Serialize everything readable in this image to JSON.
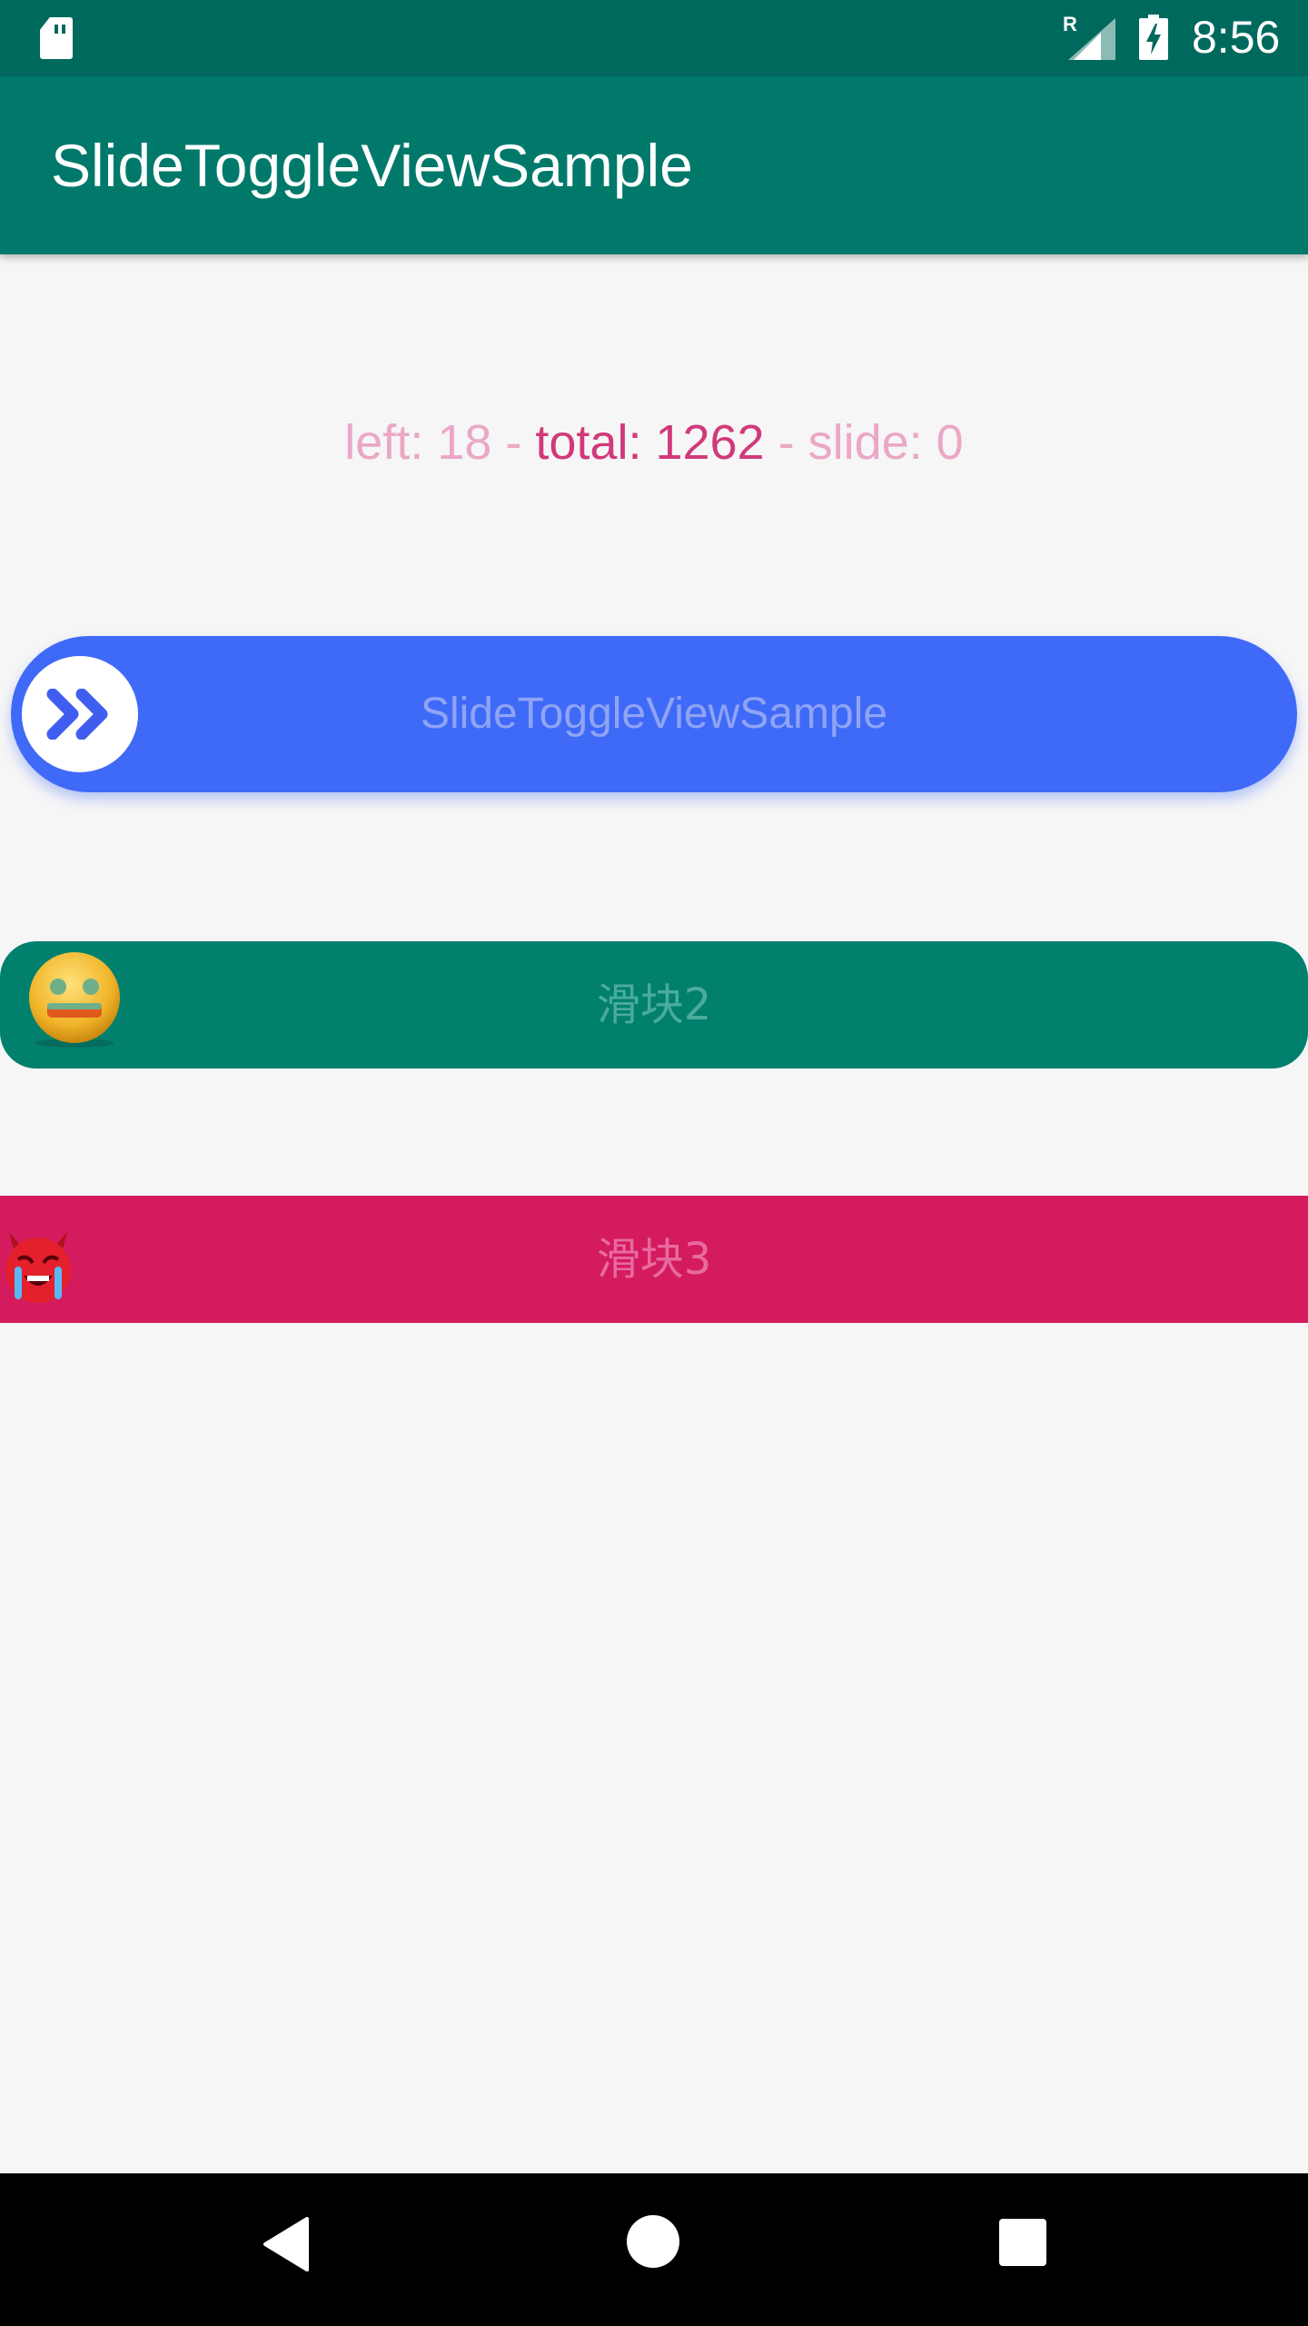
{
  "status_bar": {
    "time": "8:56",
    "network_label": "R",
    "icons": [
      "sd-card-icon",
      "signal-icon",
      "battery-charging-icon"
    ]
  },
  "app_bar": {
    "title": "SlideToggleViewSample"
  },
  "info": {
    "left": "left: 18",
    "separator": " - ",
    "total": "total: 1262",
    "slide": "slide: 0"
  },
  "sliders": [
    {
      "label": "SlideToggleViewSample",
      "thumb_icon": "double-chevron-right-icon",
      "color": "#3f69f7"
    },
    {
      "label": "滑块2",
      "thumb_icon": "smiley-face-icon",
      "color": "#00806d"
    },
    {
      "label": "滑块3",
      "thumb_icon": "devil-face-icon",
      "color": "#d41b5e"
    }
  ],
  "nav_bar": {
    "icons": [
      "back-icon",
      "home-icon",
      "recents-icon"
    ]
  },
  "colors": {
    "status_bar": "#00695d",
    "app_bar": "#00796b",
    "background": "#f6f6f6",
    "info_muted": "#eba7c6",
    "info_total": "#d1397a"
  }
}
